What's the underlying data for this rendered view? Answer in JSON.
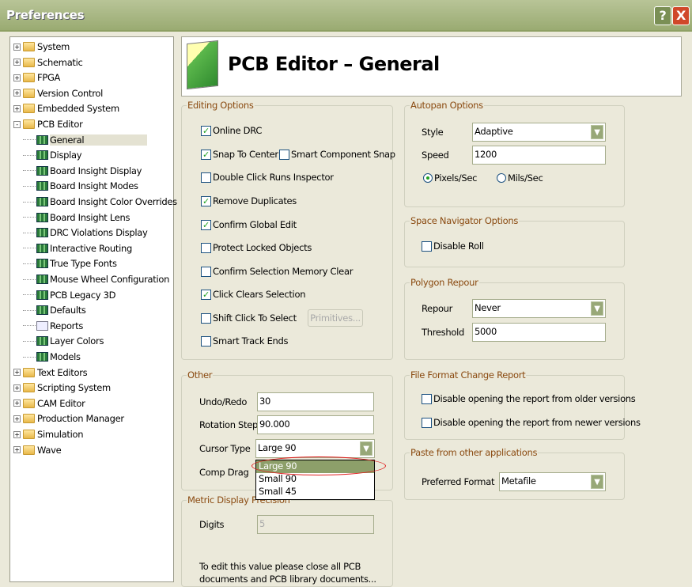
{
  "window": {
    "title": "Preferences",
    "help_label": "?",
    "close_label": "X"
  },
  "tree": {
    "items": [
      {
        "label": "System",
        "level": 0,
        "type": "folder",
        "expander": "+"
      },
      {
        "label": "Schematic",
        "level": 0,
        "type": "folder",
        "expander": "+"
      },
      {
        "label": "FPGA",
        "level": 0,
        "type": "folder",
        "expander": "+"
      },
      {
        "label": "Version Control",
        "level": 0,
        "type": "folder",
        "expander": "+"
      },
      {
        "label": "Embedded System",
        "level": 0,
        "type": "folder",
        "expander": "+"
      },
      {
        "label": "PCB Editor",
        "level": 0,
        "type": "folder",
        "expander": "-"
      },
      {
        "label": "General",
        "level": 1,
        "type": "pcb",
        "selected": true
      },
      {
        "label": "Display",
        "level": 1,
        "type": "pcb"
      },
      {
        "label": "Board Insight Display",
        "level": 1,
        "type": "pcb"
      },
      {
        "label": "Board Insight Modes",
        "level": 1,
        "type": "pcb"
      },
      {
        "label": "Board Insight Color Overrides",
        "level": 1,
        "type": "pcb"
      },
      {
        "label": "Board Insight Lens",
        "level": 1,
        "type": "pcb"
      },
      {
        "label": "DRC Violations Display",
        "level": 1,
        "type": "pcb"
      },
      {
        "label": "Interactive Routing",
        "level": 1,
        "type": "pcb"
      },
      {
        "label": "True Type Fonts",
        "level": 1,
        "type": "pcb"
      },
      {
        "label": "Mouse Wheel Configuration",
        "level": 1,
        "type": "pcb"
      },
      {
        "label": "PCB Legacy 3D",
        "level": 1,
        "type": "legacy3d"
      },
      {
        "label": "Defaults",
        "level": 1,
        "type": "pcb"
      },
      {
        "label": "Reports",
        "level": 1,
        "type": "report"
      },
      {
        "label": "Layer Colors",
        "level": 1,
        "type": "pcb"
      },
      {
        "label": "Models",
        "level": 1,
        "type": "pcb"
      },
      {
        "label": "Text Editors",
        "level": 0,
        "type": "folder",
        "expander": "+"
      },
      {
        "label": "Scripting System",
        "level": 0,
        "type": "folder",
        "expander": "+"
      },
      {
        "label": "CAM Editor",
        "level": 0,
        "type": "folder",
        "expander": "+"
      },
      {
        "label": "Production Manager",
        "level": 0,
        "type": "folder",
        "expander": "+"
      },
      {
        "label": "Simulation",
        "level": 0,
        "type": "folder",
        "expander": "+"
      },
      {
        "label": "Wave",
        "level": 0,
        "type": "folder",
        "expander": "+"
      }
    ]
  },
  "header": {
    "title": "PCB Editor – General"
  },
  "editing": {
    "title": "Editing Options",
    "online_drc": {
      "label": "Online DRC",
      "checked": true
    },
    "snap_center": {
      "label": "Snap To Center",
      "checked": true
    },
    "smart_snap": {
      "label": "Smart Component Snap",
      "checked": false
    },
    "double_click": {
      "label": "Double Click Runs Inspector",
      "checked": false
    },
    "remove_dup": {
      "label": "Remove Duplicates",
      "checked": true
    },
    "confirm_global": {
      "label": "Confirm Global Edit",
      "checked": true
    },
    "protect_locked": {
      "label": "Protect Locked Objects",
      "checked": false
    },
    "confirm_sel": {
      "label": "Confirm Selection Memory Clear",
      "checked": false
    },
    "click_clears": {
      "label": "Click Clears Selection",
      "checked": true
    },
    "shift_click": {
      "label": "Shift Click To Select",
      "checked": false
    },
    "primitives": "Primitives...",
    "smart_track": {
      "label": "Smart Track Ends",
      "checked": false
    }
  },
  "other": {
    "title": "Other",
    "undo_label": "Undo/Redo",
    "undo_value": "30",
    "rotation_label": "Rotation Step",
    "rotation_value": "90.000",
    "cursor_label": "Cursor Type",
    "cursor_value": "Large 90",
    "comp_drag_label": "Comp Drag",
    "cursor_options": [
      "Large 90",
      "Small 90",
      "Small 45"
    ]
  },
  "metric": {
    "title": "Metric Display Precision",
    "digits_label": "Digits",
    "digits_value": "5",
    "note1": "To edit this value please close all PCB",
    "note2": "documents and PCB library documents..."
  },
  "autopan": {
    "title": "Autopan Options",
    "style_label": "Style",
    "style_value": "Adaptive",
    "speed_label": "Speed",
    "speed_value": "1200",
    "pixels": "Pixels/Sec",
    "mils": "Mils/Sec",
    "selected": "Pixels/Sec"
  },
  "spacenav": {
    "title": "Space Navigator Options",
    "disable_roll": "Disable Roll"
  },
  "polygon": {
    "title": "Polygon Repour",
    "repour_label": "Repour",
    "repour_value": "Never",
    "threshold_label": "Threshold",
    "threshold_value": "5000"
  },
  "fileformat": {
    "title": "File Format Change Report",
    "older": "Disable opening the report from older versions",
    "newer": "Disable opening the report from newer versions"
  },
  "paste": {
    "title": "Paste from other applications",
    "format_label": "Preferred Format",
    "format_value": "Metafile"
  }
}
